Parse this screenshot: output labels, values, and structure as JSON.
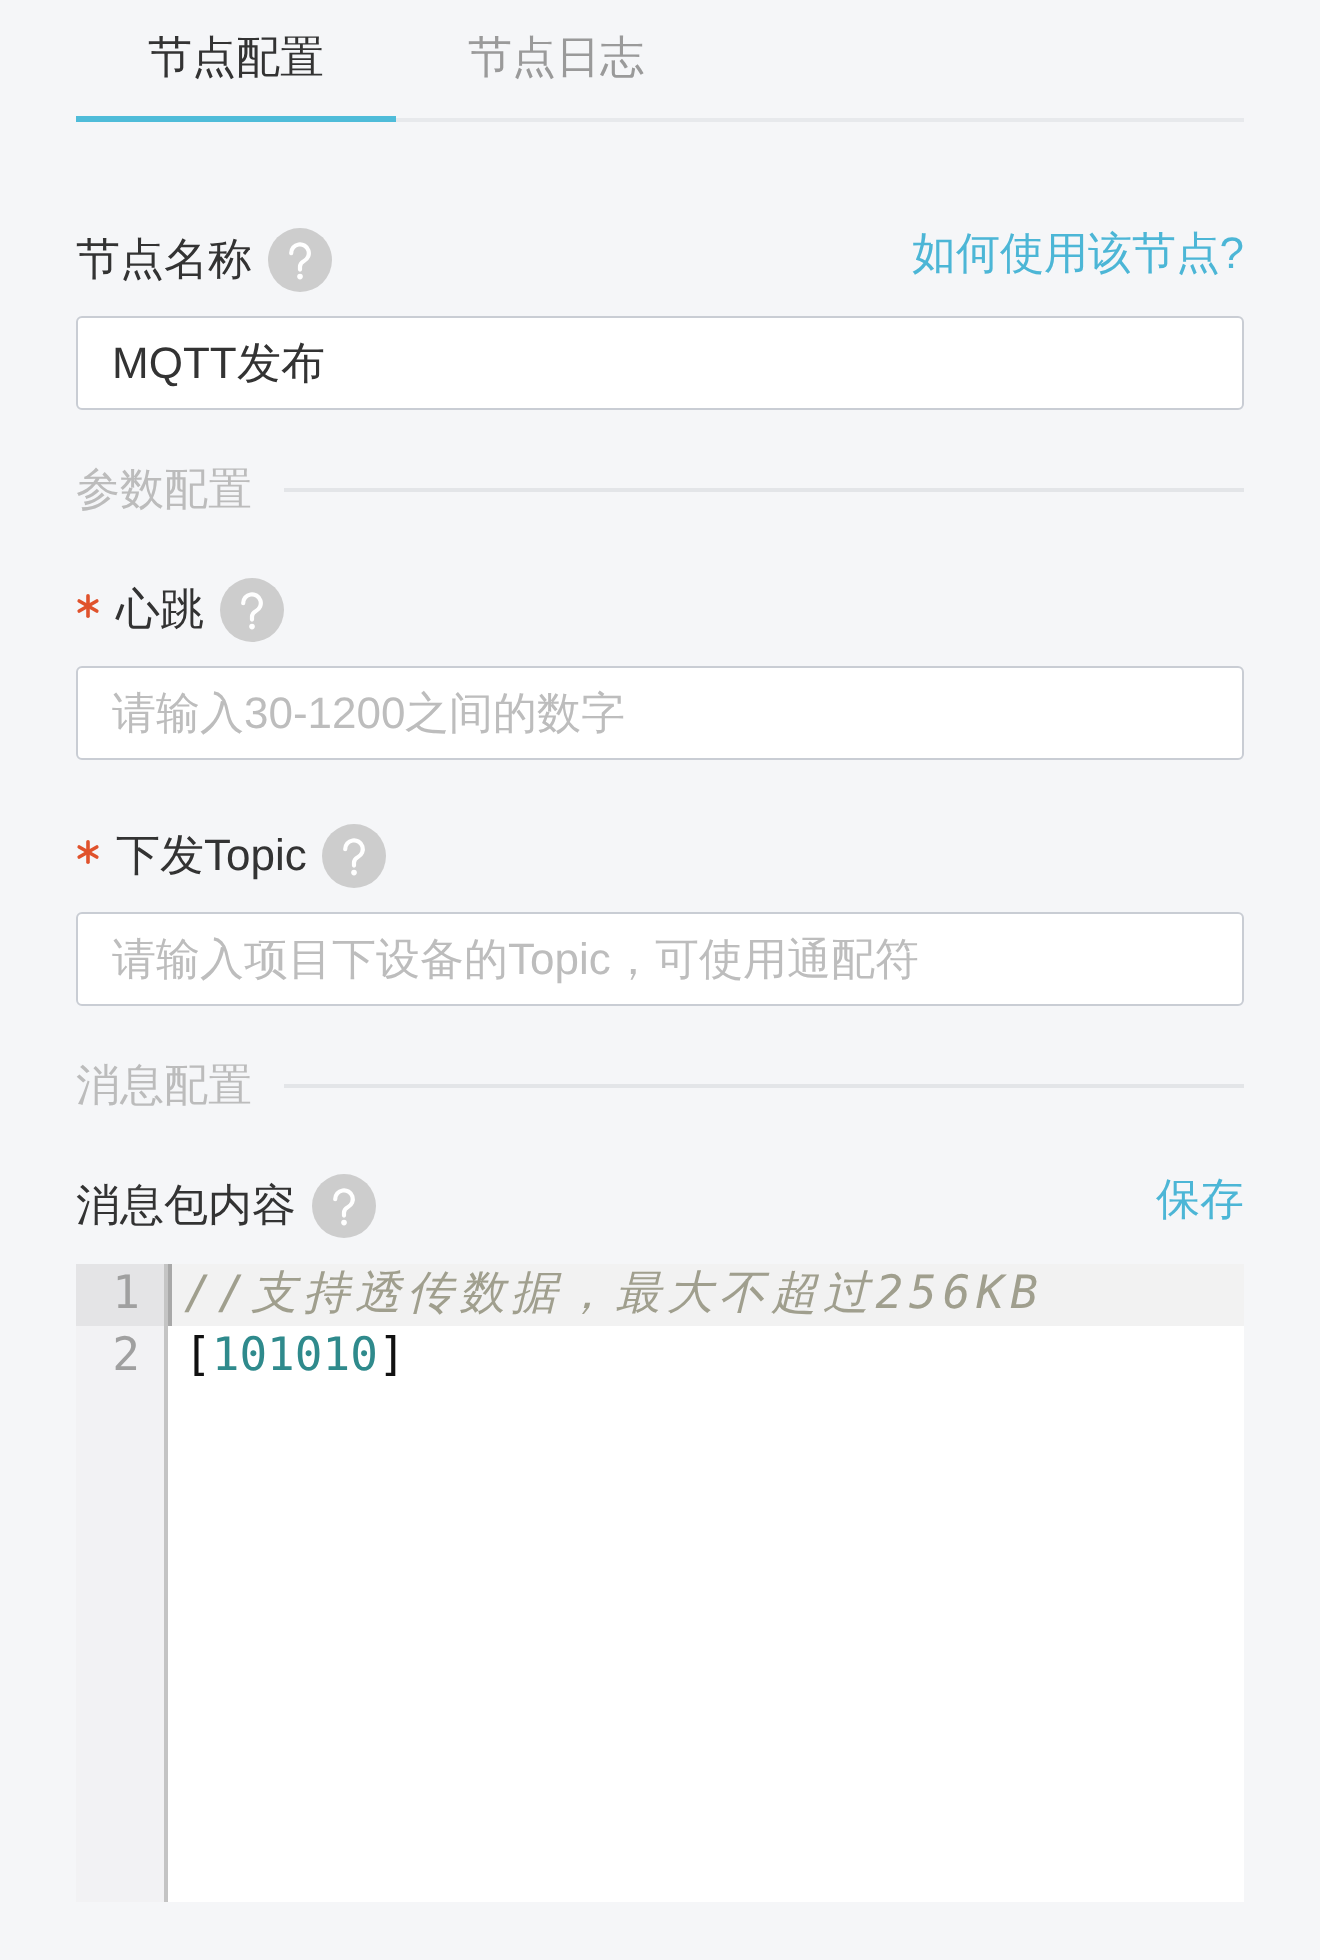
{
  "tabs": [
    {
      "label": "节点配置",
      "selected": true
    },
    {
      "label": "节点日志",
      "selected": false
    }
  ],
  "form": [
    {
      "kind": "field",
      "label": "节点名称",
      "required": false,
      "help": true,
      "link": "如何使用该节点?",
      "value": "MQTT发布"
    },
    {
      "kind": "section",
      "title": "参数配置"
    },
    {
      "kind": "field",
      "label": "心跳",
      "required": true,
      "help": true,
      "placeholder": "请输入30-1200之间的数字"
    },
    {
      "kind": "field",
      "label": "下发Topic",
      "required": true,
      "help": true,
      "placeholder": "请输入项目下设备的Topic，可使用通配符"
    },
    {
      "kind": "section",
      "title": "消息配置"
    },
    {
      "kind": "editor",
      "label": "消息包内容",
      "required": false,
      "help": true,
      "link": "保存",
      "lines": [
        {
          "number": "1",
          "active": true,
          "tokens": [
            {
              "kind": "comment",
              "text": "//支持透传数据，最大不超过256KB"
            }
          ]
        },
        {
          "number": "2",
          "active": false,
          "tokens": [
            {
              "kind": "bracket",
              "text": "["
            },
            {
              "kind": "number",
              "text": "101010"
            },
            {
              "kind": "bracket",
              "text": "]"
            }
          ]
        }
      ]
    }
  ]
}
